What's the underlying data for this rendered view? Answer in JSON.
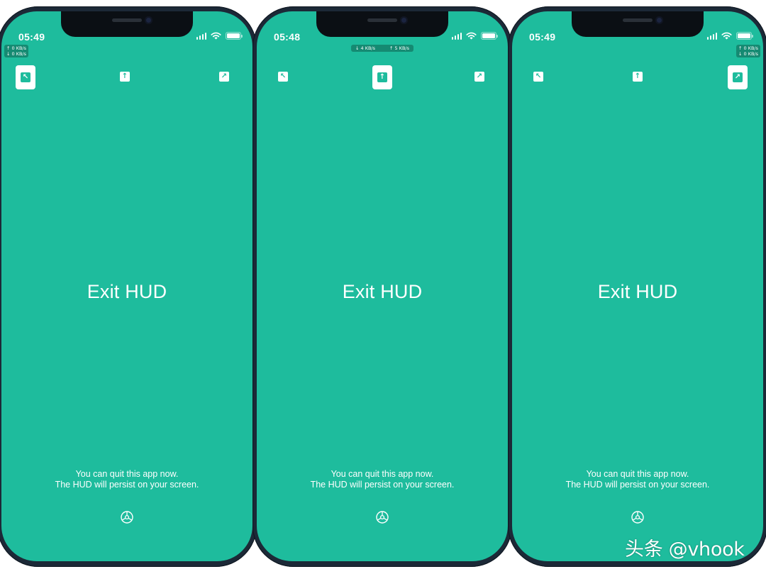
{
  "phones": [
    {
      "time": "05:49",
      "hud_style": "stack",
      "hud": {
        "up": "↑ 0 KB/s",
        "down": "↓ 0 KB/s"
      },
      "active_position": "top-left",
      "position_buttons": [
        {
          "name": "top-left",
          "glyph": "↖",
          "icon": "arrow-up-left-icon"
        },
        {
          "name": "top-center",
          "glyph": "↑",
          "icon": "arrow-up-icon"
        },
        {
          "name": "top-right",
          "glyph": "↗",
          "icon": "arrow-up-right-icon"
        }
      ],
      "title": "Exit HUD",
      "message_line1": "You can quit this app now.",
      "message_line2": "The HUD will persist on your screen."
    },
    {
      "time": "05:48",
      "hud_style": "inline",
      "hud": {
        "down": "↓ 4 KB/s",
        "up": "↑ 5 KB/s"
      },
      "active_position": "top-center",
      "position_buttons": [
        {
          "name": "top-left",
          "glyph": "↖",
          "icon": "arrow-up-left-icon"
        },
        {
          "name": "top-center",
          "glyph": "↑",
          "icon": "arrow-up-icon"
        },
        {
          "name": "top-right",
          "glyph": "↗",
          "icon": "arrow-up-right-icon"
        }
      ],
      "title": "Exit HUD",
      "message_line1": "You can quit this app now.",
      "message_line2": "The HUD will persist on your screen."
    },
    {
      "time": "05:49",
      "hud_style": "stack",
      "hud": {
        "up": "↑ 0 KB/s",
        "down": "↓ 0 KB/s"
      },
      "active_position": "top-right",
      "position_buttons": [
        {
          "name": "top-left",
          "glyph": "↖",
          "icon": "arrow-up-left-icon"
        },
        {
          "name": "top-center",
          "glyph": "↑",
          "icon": "arrow-up-icon"
        },
        {
          "name": "top-right",
          "glyph": "↗",
          "icon": "arrow-up-right-icon"
        }
      ],
      "title": "Exit HUD",
      "message_line1": "You can quit this app now.",
      "message_line2": "The HUD will persist on your screen."
    }
  ],
  "watermark": "头条 @vhook",
  "colors": {
    "screen_bg": "#1ebc9d",
    "hud_bg": "#158a72",
    "frame": "#1c2937"
  },
  "icons": {
    "settings": "gear-icon",
    "wifi": "wifi-icon",
    "signal": "cellular-signal-icon",
    "battery": "battery-icon"
  }
}
